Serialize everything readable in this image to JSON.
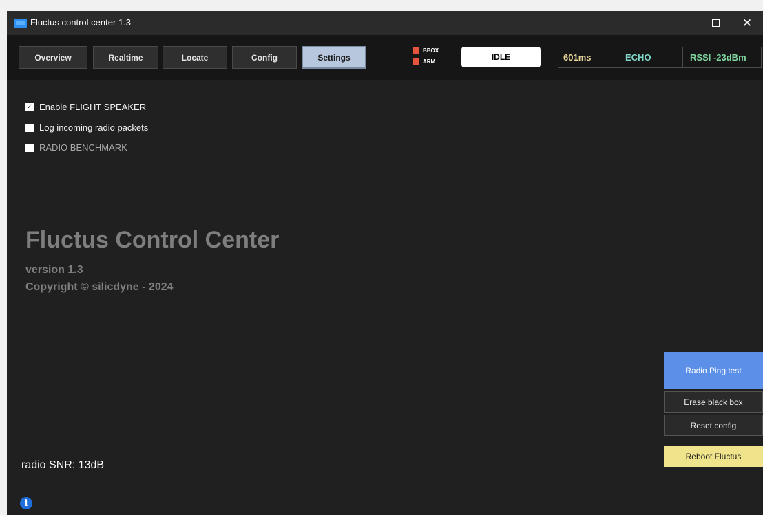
{
  "window": {
    "title": "Fluctus control center 1.3",
    "controls": {
      "minimize": "minimize",
      "maximize": "maximize",
      "close": "✕"
    }
  },
  "tabs": [
    {
      "label": "Overview"
    },
    {
      "label": "Realtime"
    },
    {
      "label": "Locate"
    },
    {
      "label": "Config"
    },
    {
      "label": "Settings",
      "active": true
    }
  ],
  "indicators": [
    {
      "label": "BBOX",
      "color": "#e8533f"
    },
    {
      "label": "ARM",
      "color": "#e8533f"
    }
  ],
  "status": {
    "state": "IDLE",
    "latency": "601ms",
    "link": "ECHO",
    "rssi": "RSSI -23dBm"
  },
  "settings": [
    {
      "label": "Enable FLIGHT SPEAKER",
      "checked": true
    },
    {
      "label": "Log incoming radio packets",
      "checked": false
    },
    {
      "label": "RADIO BENCHMARK",
      "checked": false,
      "disabled": true
    }
  ],
  "about": {
    "title": "Fluctus Control Center",
    "version": "version 1.3",
    "copyright": "Copyright © silicdyne - 2024"
  },
  "radio": {
    "snr_text": "radio SNR: 13dB"
  },
  "actions": {
    "ping": "Radio Ping test",
    "erase": "Erase black box",
    "reset": "Reset config",
    "reboot": "Reboot Fluctus"
  },
  "icons": {
    "app": "app-window-icon",
    "info": "info-icon",
    "check": "✓",
    "info_glyph": "i"
  },
  "colors": {
    "accent_blue": "#5b8fe8",
    "warning_yellow": "#efe48c",
    "indicator_red": "#e8533f",
    "active_tab": "#b7c7de"
  }
}
